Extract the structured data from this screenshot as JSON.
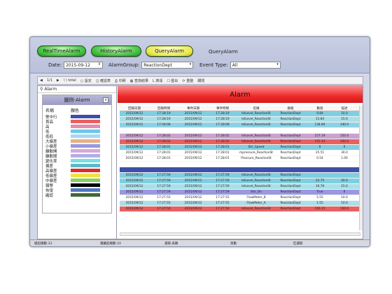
{
  "nav": {
    "realtime": "RealTimeAlarm",
    "history": "HistoryAlarm",
    "query": "QueryAlarm",
    "title": "QueryAlarm"
  },
  "filters": {
    "date_label": "Date:",
    "date_value": "2015-09-12",
    "group_label": "AlarmGroup:",
    "group_value": "ReactionDept",
    "type_label": "Event Type:",
    "type_value": "All"
  },
  "toolbar": [
    "◀",
    "1/1",
    "▶",
    "\\ \\ total",
    "○ 設定",
    "◫ 確認表",
    "⎙ 印刷",
    "▦ 查詢結果",
    "L 搜尋",
    "☐ 匯出",
    "⟳ 重整",
    "關閉"
  ],
  "tree": {
    "root": "Alarm"
  },
  "legend": {
    "title": "圖例-Alarm",
    "close": "x",
    "col_name": "名稱",
    "col_color": "顏色",
    "items": [
      {
        "name": "警中行",
        "color": "#3d4fa8"
      },
      {
        "name": "首高",
        "color": "#e86060"
      },
      {
        "name": "高",
        "color": "#e88ab0"
      },
      {
        "name": "低",
        "color": "#70c8e8"
      },
      {
        "name": "低低",
        "color": "#a8d8f0"
      },
      {
        "name": "大偏差",
        "color": "#e8b088"
      },
      {
        "name": "小偏差",
        "color": "#9a98e0"
      },
      {
        "name": "離散開",
        "color": "#d8a8d8"
      },
      {
        "name": "離散關",
        "color": "#b0b0e8"
      },
      {
        "name": "變化率",
        "color": "#78e0e0"
      },
      {
        "name": "偏差",
        "color": "#60b8c8"
      },
      {
        "name": "高偏差",
        "color": "#e02828"
      },
      {
        "name": "低偏差",
        "color": "#f0e040"
      },
      {
        "name": "中偏差",
        "color": "#88d060"
      },
      {
        "name": "報警",
        "color": "#000000"
      },
      {
        "name": "恢復",
        "color": "#5078c0"
      },
      {
        "name": "確認",
        "color": "#406838"
      }
    ]
  },
  "alarm": {
    "banner": "Alarm",
    "headers": [
      "回報日期",
      "回報時間",
      "事件日期",
      "事件時間",
      "名稱",
      "群組",
      "數值",
      "描述"
    ],
    "rows": [
      {
        "bg": "#7fcfe0",
        "cells": [
          "2015/09/12",
          "17:28:19",
          "2015/09/12",
          "17:28:19",
          "lelLevel_ReactionSt",
          "ReactionDept",
          "9.84",
          "10.0"
        ]
      },
      {
        "bg": "#a9dfe8",
        "cells": [
          "2015/09/12",
          "17:28:19",
          "2015/09/12",
          "17:28:19",
          "lelLevel_ReactionSt",
          "ReactionDept",
          "15.84",
          "15.0"
        ]
      },
      {
        "bg": "#8dd2e4",
        "cells": [
          "2015/09/12",
          "17:28:08",
          "2015/09/12",
          "17:28:08",
          "lelLevel_ReactionSt",
          "ReactionDept",
          "134.84",
          "140.0"
        ]
      },
      {
        "bg": "#ffffff",
        "cells": [
          "",
          "",
          "",
          "",
          "",
          "",
          "",
          ""
        ]
      },
      {
        "bg": "#c9a2cf",
        "cells": [
          "2015/09/12",
          "17:28:02",
          "2015/09/12",
          "17:28:02",
          "lelLevel_ReactionSt",
          "ReactionDept",
          "157.19",
          "150.0"
        ]
      },
      {
        "bg": "#e86060",
        "cells": [
          "2015/09/12",
          "17:28:02",
          "2015/09/12",
          "17:28:02",
          "lelLevel_ReactionSt",
          "ReactionDept",
          "155.14",
          "150.0"
        ]
      },
      {
        "bg": "#7fcfe0",
        "cells": [
          "2015/09/12",
          "17:28:01",
          "2015/09/12",
          "17:28:01",
          "Stir_Speed",
          "ReactionDept",
          "0",
          "0"
        ]
      },
      {
        "bg": "#ffffff",
        "cells": [
          "2015/09/12",
          "17:28:01",
          "2015/09/12",
          "17:28:01",
          "mpressure_ReactionSt",
          "ReactionDept",
          "25.51",
          "30.0"
        ]
      },
      {
        "bg": "#ffffff",
        "cells": [
          "2015/09/12",
          "17:28:01",
          "2015/09/12",
          "17:28:01",
          "Pressure_ReactionSt",
          "ReactionDept",
          "0.54",
          "1.00"
        ]
      },
      {
        "bg": "#ffffff",
        "cells": [
          "",
          "",
          "",
          "",
          "",
          "",
          "",
          ""
        ]
      },
      {
        "bg": "#3d4fa8",
        "cells": [
          "",
          "",
          "",
          "",
          "",
          "",
          "",
          ""
        ]
      },
      {
        "bg": "#7fcfe0",
        "cells": [
          "2015/09/12",
          "17:27:59",
          "2015/09/12",
          "17:27:59",
          "lelLevel_ReactionSt",
          "ReactionDept",
          "",
          ""
        ]
      },
      {
        "bg": "#7fcfe0",
        "cells": [
          "2015/09/12",
          "17:27:59",
          "2015/09/12",
          "17:27:59",
          "lelLevel_ReactionSt",
          "ReactionDept",
          "22.75",
          "20.0"
        ]
      },
      {
        "bg": "#a9dfe8",
        "cells": [
          "2015/09/12",
          "17:27:59",
          "2015/09/12",
          "17:27:59",
          "lelLevel_ReactionSt",
          "ReactionDept",
          "16.78",
          "15.0"
        ]
      },
      {
        "bg": "#9a98e0",
        "cells": [
          "2015/09/12",
          "17:27:59",
          "2015/09/12",
          "17:27:59",
          "Stir_On",
          "ReactionDept",
          "True",
          "0"
        ]
      },
      {
        "bg": "#ffffff",
        "cells": [
          "2015/09/12",
          "17:27:55",
          "2015/09/12",
          "17:27:55",
          "FlowMeter_B",
          "ReactionDept",
          "5.55",
          "10.0"
        ]
      },
      {
        "bg": "#a9dfe8",
        "cells": [
          "2015/09/12",
          "17:27:55",
          "2015/09/12",
          "17:27:55",
          "FlowMeter_A",
          "ReactionDept",
          "1.55",
          "10.0"
        ]
      },
      {
        "bg": "#e86060",
        "cells": [
          "2015/09/12",
          "17:27:50",
          "2015/09/12",
          "17:27:50",
          "lelLevel_ReactionSt",
          "ReactionDept",
          "156.15",
          "150.0"
        ]
      }
    ]
  },
  "status": [
    "組起總數:33",
    "隱藏起總數:33",
    "選取:表數",
    "頁數",
    "匹選取"
  ]
}
